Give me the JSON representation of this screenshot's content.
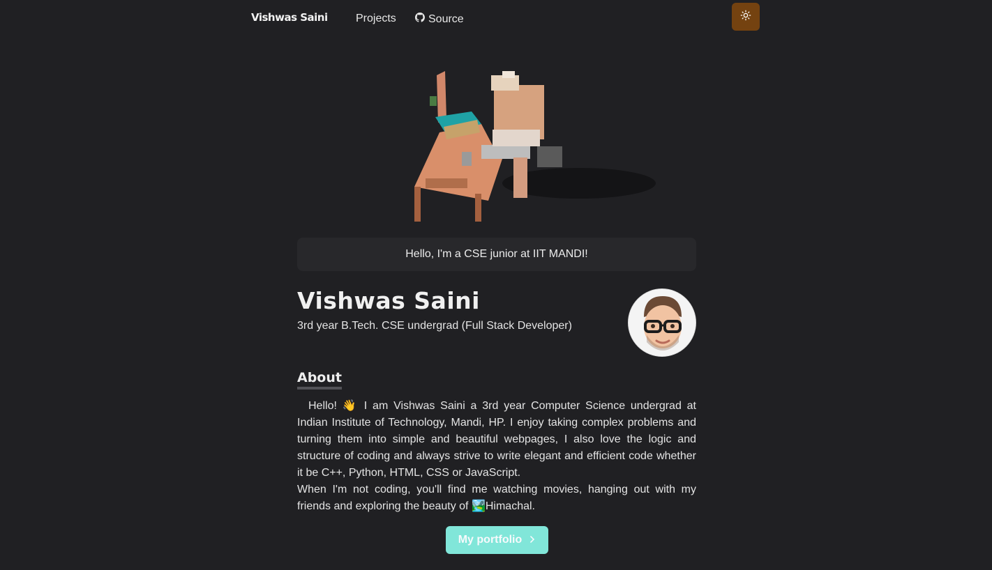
{
  "nav": {
    "brand": "Vishwas Saini",
    "links": [
      {
        "label": "Projects"
      },
      {
        "label": "Source",
        "icon": "github-icon"
      }
    ],
    "theme_toggle_icon": "sun-icon"
  },
  "greeting": "Hello, I'm a CSE junior at IIT MANDI!",
  "profile": {
    "name": "Vishwas Saini",
    "subtitle": "3rd year B.Tech. CSE undergrad (Full Stack Developer)"
  },
  "about": {
    "title": "About",
    "paragraphs": [
      "Hello! 👋 I am Vishwas Saini a 3rd year Computer Science undergrad at Indian Institute of Technology, Mandi, HP. I enjoy taking complex problems and turning them into simple and beautiful webpages, I also love the logic and structure of coding and always strive to write elegant and efficient code whether it be C++, Python, HTML, CSS or JavaScript.",
      "When I'm not coding, you'll find me watching movies, hanging out with my friends and exploring the beauty of 🏞️Himachal."
    ]
  },
  "cta": {
    "label": "My portfolio",
    "icon": "chevron-right-icon"
  },
  "colors": {
    "background": "#202023",
    "theme_button": "#744210",
    "cta_button": "#81e6d9",
    "greeting_box": "#28282b"
  }
}
